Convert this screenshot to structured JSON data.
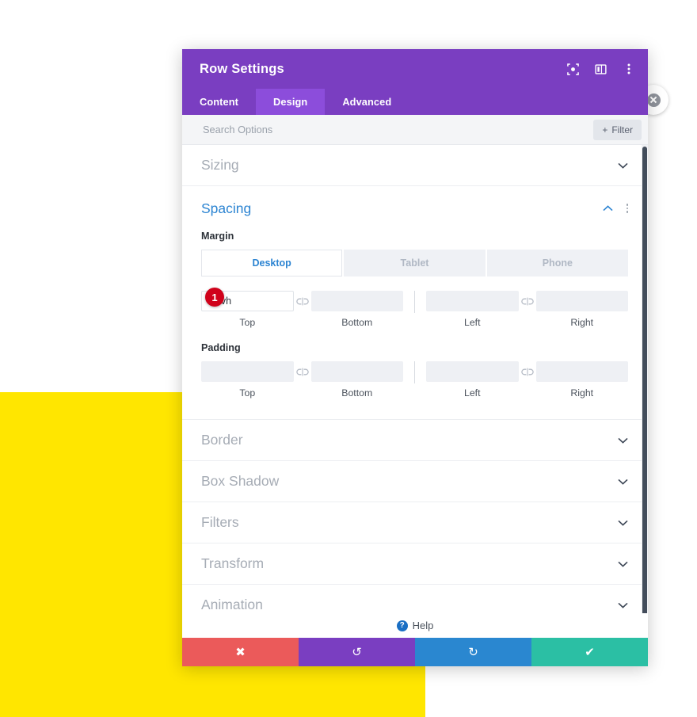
{
  "page": {
    "background_block_color": "#ffe600"
  },
  "close_button": {
    "icon": "close-circle-icon"
  },
  "panel": {
    "title": "Row Settings",
    "header_icons": [
      {
        "name": "focus-target-icon"
      },
      {
        "name": "layout-columns-icon"
      },
      {
        "name": "kebab-menu-icon"
      }
    ],
    "tabs": [
      {
        "label": "Content",
        "active": false
      },
      {
        "label": "Design",
        "active": true
      },
      {
        "label": "Advanced",
        "active": false
      }
    ],
    "search": {
      "placeholder": "Search Options",
      "value": ""
    },
    "filter_button": {
      "label": "Filter",
      "icon": "plus-icon"
    },
    "sections": [
      {
        "name": "sizing",
        "title": "Sizing",
        "open": false
      },
      {
        "name": "spacing",
        "title": "Spacing",
        "open": true
      },
      {
        "name": "border",
        "title": "Border",
        "open": false
      },
      {
        "name": "box-shadow",
        "title": "Box Shadow",
        "open": false
      },
      {
        "name": "filters",
        "title": "Filters",
        "open": false
      },
      {
        "name": "transform",
        "title": "Transform",
        "open": false
      },
      {
        "name": "animation",
        "title": "Animation",
        "open": false
      }
    ],
    "spacing": {
      "device_tabs": [
        {
          "label": "Desktop",
          "active": true
        },
        {
          "label": "Tablet",
          "active": false
        },
        {
          "label": "Phone",
          "active": false
        }
      ],
      "margin": {
        "label": "Margin",
        "top": {
          "caption": "Top",
          "value": "20vh",
          "placeholder": ""
        },
        "bottom": {
          "caption": "Bottom",
          "value": "",
          "placeholder": ""
        },
        "left": {
          "caption": "Left",
          "value": "",
          "placeholder": ""
        },
        "right": {
          "caption": "Right",
          "value": "",
          "placeholder": ""
        },
        "link_icon": "link-broken-icon"
      },
      "padding": {
        "label": "Padding",
        "top": {
          "caption": "Top",
          "value": "",
          "placeholder": ""
        },
        "bottom": {
          "caption": "Bottom",
          "value": "",
          "placeholder": ""
        },
        "left": {
          "caption": "Left",
          "value": "",
          "placeholder": ""
        },
        "right": {
          "caption": "Right",
          "value": "",
          "placeholder": ""
        },
        "link_icon": "link-broken-icon"
      }
    },
    "step_badge": {
      "number": "1",
      "color": "#d0021b"
    },
    "help": {
      "label": "Help",
      "icon_glyph": "?"
    },
    "footer_buttons": [
      {
        "name": "cancel",
        "glyph": "✖",
        "color": "#eb5a5a"
      },
      {
        "name": "undo",
        "glyph": "↺",
        "color": "#7a3ec1"
      },
      {
        "name": "redo",
        "glyph": "↻",
        "color": "#2a87d0"
      },
      {
        "name": "save",
        "glyph": "✔",
        "color": "#2bbfa4"
      }
    ]
  }
}
